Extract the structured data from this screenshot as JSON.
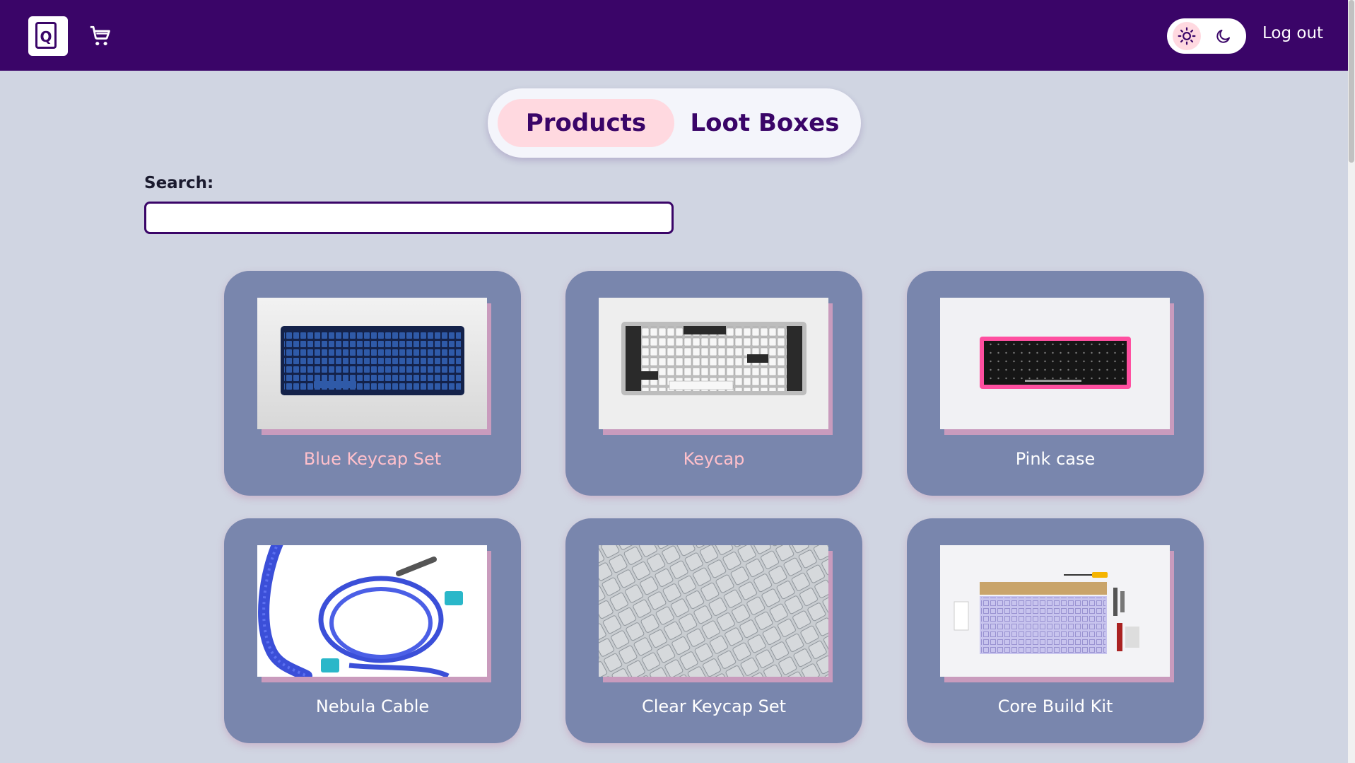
{
  "header": {
    "logo_letter": "Q",
    "cart_icon": "cart-icon",
    "theme": {
      "light_icon": "sun-icon",
      "dark_icon": "moon-icon",
      "selected": "light"
    },
    "logout_label": "Log out"
  },
  "tabs": [
    {
      "label": "Products",
      "active": true
    },
    {
      "label": "Loot Boxes",
      "active": false
    }
  ],
  "search": {
    "label": "Search:",
    "value": ""
  },
  "products": [
    {
      "name": "Blue Keycap Set",
      "image": "blue-keyboard",
      "name_color": "#ffc0cb"
    },
    {
      "name": "Keycap",
      "image": "white-black-keyboard",
      "name_color": "#ffc0cb"
    },
    {
      "name": "Pink case",
      "image": "pink-case-keyboard",
      "name_color": "#ffffff"
    },
    {
      "name": "Nebula Cable",
      "image": "coiled-cable",
      "name_color": "#ffffff"
    },
    {
      "name": "Clear Keycap Set",
      "image": "clear-keycaps",
      "name_color": "#ffffff"
    },
    {
      "name": "Core Build Kit",
      "image": "build-kit",
      "name_color": "#ffffff"
    }
  ],
  "colors": {
    "header_bg": "#3a0568",
    "page_bg": "#d0d5e2",
    "card_bg": "#7986ad",
    "accent_pink": "#ffd9e0"
  }
}
